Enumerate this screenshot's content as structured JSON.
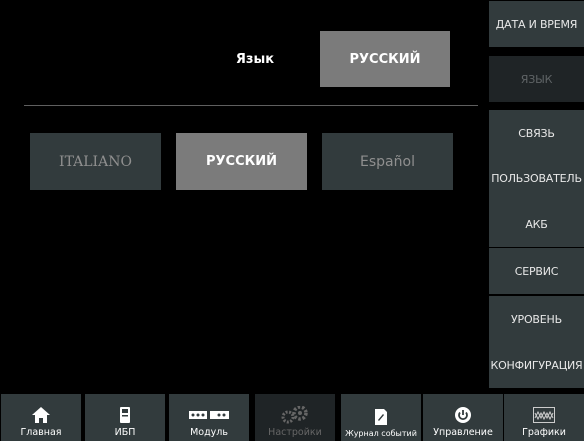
{
  "main": {
    "language_label": "Язык",
    "current_language": "РУССКИЙ",
    "options": [
      {
        "label": "ITALIANO",
        "selected": false
      },
      {
        "label": "РУССКИЙ",
        "selected": true
      },
      {
        "label": "Español",
        "selected": false
      }
    ]
  },
  "right_menu": {
    "items": [
      {
        "label": "ДАТА И ВРЕМЯ",
        "active": false
      },
      {
        "label": "ЯЗЫК",
        "active": true
      },
      {
        "label": "СВЯЗЬ",
        "active": false
      },
      {
        "label": "ПОЛЬЗОВАТЕЛЬ",
        "active": false
      },
      {
        "label": "АКБ",
        "active": false
      },
      {
        "label": "СЕРВИС",
        "active": false
      },
      {
        "label": "УРОВЕНЬ",
        "active": false
      },
      {
        "label": "КОНФИГУРАЦИЯ",
        "active": false
      }
    ]
  },
  "bottom_nav": {
    "items": [
      {
        "label": "Главная",
        "icon": "home-icon",
        "active": false
      },
      {
        "label": "ИБП",
        "icon": "ups-icon",
        "active": false
      },
      {
        "label": "Модуль",
        "icon": "module-icon",
        "active": false
      },
      {
        "label": "Настройки",
        "icon": "gear-icon",
        "active": true
      },
      {
        "label": "Журнал событий",
        "icon": "event-log-icon",
        "active": false
      },
      {
        "label": "Управление",
        "icon": "power-icon",
        "active": false
      },
      {
        "label": "Графики",
        "icon": "graph-icon",
        "active": false
      }
    ]
  },
  "colors": {
    "button": "#323b3d",
    "button_selected": "#7b7b7b",
    "button_active": "#1f2426",
    "background": "#000000"
  }
}
